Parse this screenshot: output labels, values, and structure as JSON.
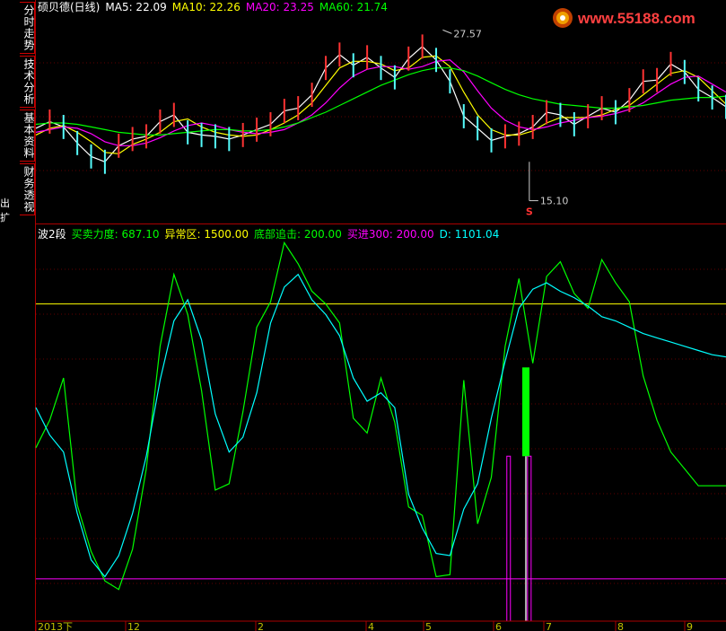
{
  "sidebar": {
    "tabs": [
      "分时走势",
      "技术分析",
      "基本资料",
      "财务透视"
    ],
    "left_label": "出 扩"
  },
  "logo": {
    "text": "www.55188.com"
  },
  "price_panel": {
    "stock_label": "硕贝德(日线)",
    "indicators": [
      {
        "name": "MA5",
        "value": "22.09",
        "color": "#ffffff"
      },
      {
        "name": "MA10",
        "value": "22.26",
        "color": "#ffff00"
      },
      {
        "name": "MA20",
        "value": "23.25",
        "color": "#ff00ff"
      },
      {
        "name": "MA60",
        "value": "21.74",
        "color": "#00ff00"
      }
    ],
    "high_label": "27.57",
    "low_label": "15.10",
    "signal_label": "S"
  },
  "osc_panel": {
    "title": "波2段",
    "indicators": [
      {
        "name": "买卖力度",
        "value": "687.10",
        "color": "#00ff00"
      },
      {
        "name": "异常区",
        "value": "1500.00",
        "color": "#ffff00"
      },
      {
        "name": "底部追击",
        "value": "200.00",
        "color": "#00ff00"
      },
      {
        "name": "买进300",
        "value": "200.00",
        "color": "#ff00ff"
      },
      {
        "name": "D",
        "value": "1101.04",
        "color": "#00ffff"
      }
    ]
  },
  "x_axis": {
    "labels": [
      "2013下",
      "12",
      "2",
      "4",
      "5",
      "6",
      "7",
      "8",
      "9"
    ]
  },
  "chart_data": [
    {
      "type": "line",
      "title": "硕贝德(日线)",
      "ylim": [
        14,
        29
      ],
      "x": [
        0,
        4,
        8,
        12,
        16,
        20,
        24,
        28,
        32,
        36,
        40,
        44,
        48,
        52,
        56,
        60,
        64,
        68,
        72,
        76,
        80,
        84,
        88,
        92,
        96,
        100,
        104,
        108,
        112,
        116,
        120,
        124,
        128,
        132,
        136,
        140,
        144,
        148,
        152,
        156,
        160,
        164,
        168,
        172,
        176,
        180,
        184,
        188,
        192,
        196,
        200
      ],
      "series": [
        {
          "name": "MA5",
          "color": "#ffffff",
          "values": [
            20.5,
            21,
            20.6,
            19.4,
            18.4,
            18,
            19.2,
            19.7,
            19.9,
            21,
            21.5,
            20.2,
            20,
            19.9,
            19.7,
            20,
            20.4,
            20.8,
            21.8,
            22,
            23,
            25,
            26,
            25.2,
            25.8,
            25,
            24.3,
            25.7,
            26.6,
            25.6,
            24,
            21.4,
            20.5,
            19.6,
            19.9,
            20.1,
            20.6,
            21.7,
            21.5,
            20.8,
            21.4,
            22,
            21.7,
            22.6,
            24,
            24.1,
            25.3,
            24.7,
            23.4,
            22.8,
            22.1
          ]
        },
        {
          "name": "MA10",
          "color": "#ffff00",
          "values": [
            20,
            20.5,
            20.7,
            20.2,
            19.5,
            18.7,
            18.6,
            19.3,
            19.7,
            20.2,
            21,
            21.2,
            20.6,
            20.2,
            20,
            19.9,
            20,
            20.4,
            20.9,
            21.5,
            22.4,
            23.7,
            25,
            25.5,
            25.5,
            25.3,
            24.8,
            25,
            25.8,
            25.9,
            25.1,
            23.2,
            21.5,
            20.4,
            20,
            20,
            20.3,
            20.9,
            21.3,
            21.3,
            21.3,
            21.5,
            21.9,
            22.2,
            23,
            23.8,
            24.6,
            24.8,
            24.3,
            23.3,
            22.3
          ]
        },
        {
          "name": "MA20",
          "color": "#ff00ff",
          "values": [
            20.2,
            20.4,
            20.6,
            20.5,
            20.1,
            19.5,
            19.2,
            19.2,
            19.4,
            19.8,
            20.3,
            20.7,
            20.9,
            20.7,
            20.4,
            20.2,
            20.1,
            20.2,
            20.4,
            20.9,
            21.5,
            22.4,
            23.5,
            24.4,
            24.9,
            25.1,
            25.1,
            24.9,
            25.1,
            25.5,
            25.6,
            24.7,
            23.3,
            22,
            21.1,
            20.6,
            20.4,
            20.6,
            20.9,
            21.1,
            21.3,
            21.4,
            21.6,
            21.9,
            22.4,
            23.1,
            23.8,
            24.3,
            24.4,
            23.8,
            23.2
          ]
        },
        {
          "name": "MA60",
          "color": "#00ff00",
          "values": [
            20.8,
            20.9,
            20.9,
            20.8,
            20.6,
            20.4,
            20.2,
            20.1,
            20,
            20,
            20.1,
            20.2,
            20.3,
            20.4,
            20.4,
            20.3,
            20.3,
            20.4,
            20.6,
            20.9,
            21.3,
            21.7,
            22.2,
            22.7,
            23.2,
            23.7,
            24.1,
            24.5,
            24.8,
            25,
            25,
            24.8,
            24.4,
            23.9,
            23.4,
            23,
            22.7,
            22.5,
            22.3,
            22.2,
            22.1,
            22,
            22,
            22.1,
            22.2,
            22.4,
            22.6,
            22.7,
            22.8,
            22.8,
            22.9
          ]
        }
      ]
    },
    {
      "type": "line",
      "title": "波2段",
      "ylim": [
        0,
        1800
      ],
      "reference_lines": [
        {
          "name": "异常区",
          "value": 1500,
          "color": "#ffff00"
        },
        {
          "name": "底部追击",
          "value": 200,
          "color": "#ff00ff"
        }
      ],
      "x": [
        0,
        4,
        8,
        12,
        16,
        20,
        24,
        28,
        32,
        36,
        40,
        44,
        48,
        52,
        56,
        60,
        64,
        68,
        72,
        76,
        80,
        84,
        88,
        92,
        96,
        100,
        104,
        108,
        112,
        116,
        120,
        124,
        128,
        132,
        136,
        140,
        144,
        148,
        152,
        156,
        160,
        164,
        168,
        172,
        176,
        180,
        184,
        188,
        192,
        196,
        200
      ],
      "series": [
        {
          "name": "买卖力度",
          "color": "#00ff00",
          "values": [
            820,
            950,
            1150,
            550,
            330,
            190,
            150,
            340,
            720,
            1300,
            1640,
            1450,
            1090,
            620,
            650,
            990,
            1390,
            1510,
            1790,
            1690,
            1560,
            1500,
            1410,
            960,
            890,
            1150,
            940,
            540,
            500,
            210,
            220,
            1140,
            460,
            680,
            1300,
            1620,
            1220,
            1630,
            1700,
            1550,
            1480,
            1710,
            1600,
            1510,
            1160,
            950,
            800,
            720,
            640,
            640,
            640
          ]
        },
        {
          "name": "D",
          "color": "#00ffff",
          "values": [
            1010,
            880,
            800,
            510,
            290,
            210,
            310,
            510,
            780,
            1140,
            1420,
            1520,
            1330,
            980,
            800,
            870,
            1080,
            1410,
            1580,
            1640,
            1520,
            1450,
            1350,
            1150,
            1040,
            1080,
            1010,
            600,
            440,
            320,
            310,
            530,
            650,
            960,
            1230,
            1480,
            1570,
            1600,
            1560,
            1530,
            1490,
            1440,
            1420,
            1390,
            1360,
            1340,
            1320,
            1300,
            1280,
            1260,
            1250
          ]
        }
      ],
      "bars": [
        {
          "name": "买进300",
          "color": "#ff00ff",
          "x": 137,
          "value": 780
        },
        {
          "name": "买进300",
          "color": "#ff00ff",
          "x": 143,
          "value": 780
        },
        {
          "name": "底部追击",
          "color": "#00ff00",
          "x": 142,
          "value": 1200
        }
      ]
    }
  ]
}
